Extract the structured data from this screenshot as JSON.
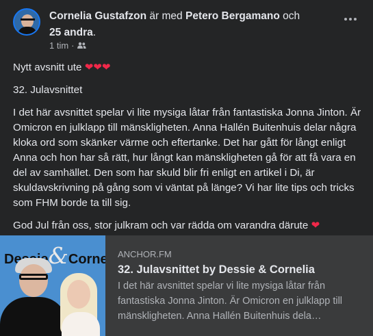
{
  "post": {
    "author": "Cornelia Gustafzon",
    "with_text": "är med",
    "tagged": "Petero Bergamano",
    "and_text": "och",
    "others": "25 andra",
    "period": ".",
    "time": "1 tim",
    "separator": "·",
    "audience_icon": "friends-icon",
    "more_icon": "more-options-icon"
  },
  "content": {
    "line1": "Nytt avsnitt ute",
    "hearts": "❤❤❤",
    "line2": "32. Julavsnittet",
    "paragraph": "I det här avsnittet spelar vi lite mysiga låtar från fantastiska Jonna Jinton. Är Omicron en julklapp till mänskligheten. Anna Hallén Buitenhuis delar några kloka ord som skänker värme och eftertanke. Det har gått för långt enligt Anna och hon har så rätt, hur långt kan mänskligheten gå för att få vara en del av samhället. Den som har skuld blir fri enligt en artikel i Di, är skuldavskrivning på gång som vi väntat på länge? Vi har lite tips och tricks som FHM borde ta till sig.",
    "closing": "God Jul från oss, stor julkram och var rädda om varandra därute",
    "closing_heart": "❤"
  },
  "link": {
    "thumb_left": "Dessie",
    "thumb_amp": "&",
    "thumb_right": "Cornelia",
    "domain": "ANCHOR.FM",
    "title": "32. Julavsnittet by Dessie & Cornelia",
    "description": "I det här avsnittet spelar vi lite mysiga låtar från fantastiska Jonna Jinton. Är Omicron en julklapp till mänskligheten. Anna Hallén Buitenhuis dela…"
  },
  "colors": {
    "background": "#242526",
    "text": "#e4e6eb",
    "secondary": "#b0b3b8",
    "heart": "#f02849",
    "card": "#3a3b3c",
    "thumb_bg": "#4a8fd0"
  }
}
